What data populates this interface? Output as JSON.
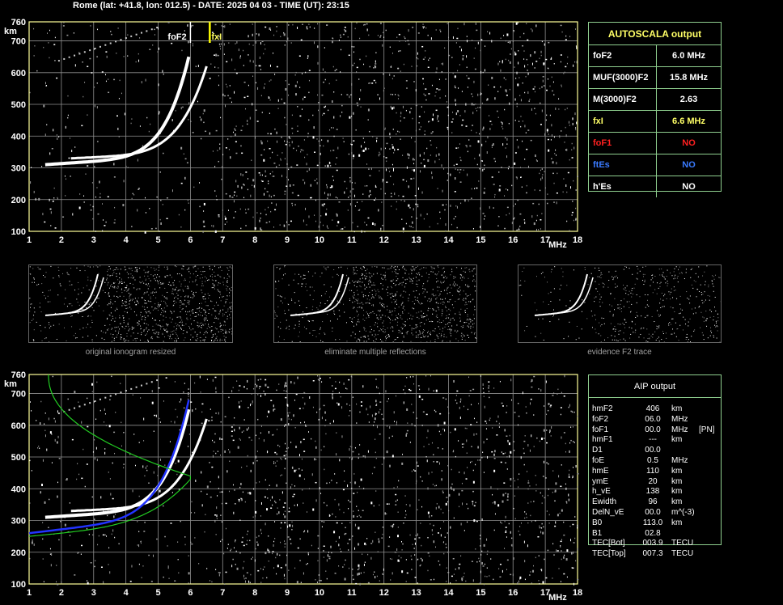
{
  "header": {
    "text": "Rome (lat: +41.8, lon: 012.5) - DATE: 2025 04 03 - TIME (UT): 23:15"
  },
  "plot": {
    "y_ticks": [
      "760",
      "700",
      "600",
      "500",
      "400",
      "300",
      "200",
      "100"
    ],
    "y_unit": "km",
    "x_ticks": [
      "1",
      "2",
      "3",
      "4",
      "5",
      "6",
      "7",
      "8",
      "9",
      "10",
      "11",
      "12",
      "13",
      "14",
      "15",
      "16",
      "17",
      "18"
    ],
    "x_unit": "MHz",
    "fof2_marker": "foF2",
    "fxi_marker": "fxI"
  },
  "autoscala": {
    "title": "AUTOSCALA output",
    "rows": [
      {
        "key": "foF2",
        "value": "6.0 MHz",
        "color": "#ffffff"
      },
      {
        "key": "MUF(3000)F2",
        "value": "15.8 MHz",
        "color": "#ffffff"
      },
      {
        "key": "M(3000)F2",
        "value": "2.63",
        "color": "#ffffff"
      },
      {
        "key": "fxI",
        "value": "6.6 MHz",
        "color": "#ffff66"
      },
      {
        "key": "foF1",
        "value": "NO",
        "color": "#ff2020"
      },
      {
        "key": "ftEs",
        "value": "NO",
        "color": "#3a7bff"
      },
      {
        "key": "h'Es",
        "value": "NO",
        "color": "#ffffff"
      }
    ]
  },
  "thumbnails": {
    "captions": [
      "original ionogram resized",
      "eliminate multiple reflections",
      "evidence F2 trace"
    ]
  },
  "aip": {
    "title": "AIP output",
    "rows": [
      {
        "name": "hmF2",
        "value": "406",
        "unit": "km",
        "extra": ""
      },
      {
        "name": "foF2",
        "value": "06.0",
        "unit": "MHz",
        "extra": ""
      },
      {
        "name": "foF1",
        "value": "00.0",
        "unit": "MHz",
        "extra": "[PN]"
      },
      {
        "name": "hmF1",
        "value": "---",
        "unit": "km",
        "extra": ""
      },
      {
        "name": "D1",
        "value": "00.0",
        "unit": "",
        "extra": ""
      },
      {
        "name": "foE",
        "value": "0.5",
        "unit": "MHz",
        "extra": ""
      },
      {
        "name": "hmE",
        "value": "110",
        "unit": "km",
        "extra": ""
      },
      {
        "name": "ymE",
        "value": "20",
        "unit": "km",
        "extra": ""
      },
      {
        "name": "h_vE",
        "value": "138",
        "unit": "km",
        "extra": ""
      },
      {
        "name": "Ewidth",
        "value": "96",
        "unit": "km",
        "extra": ""
      },
      {
        "name": "DelN_vE",
        "value": "00.0",
        "unit": "m^(-3)",
        "extra": ""
      },
      {
        "name": "B0",
        "value": "113.0",
        "unit": "km",
        "extra": ""
      },
      {
        "name": "B1",
        "value": "02.8",
        "unit": "",
        "extra": ""
      },
      {
        "name": "TEC[Bot]",
        "value": "003.9",
        "unit": "TECU",
        "extra": ""
      },
      {
        "name": "TEC[Top]",
        "value": "007.3",
        "unit": "TECU",
        "extra": ""
      }
    ]
  },
  "colors": {
    "grid": "#909090",
    "frame": "#ffff99",
    "panel_border": "#8fcf8f",
    "fxi_marker": "#ffff00",
    "profile_blue": "#2233ff",
    "profile_green": "#22cc22"
  }
}
